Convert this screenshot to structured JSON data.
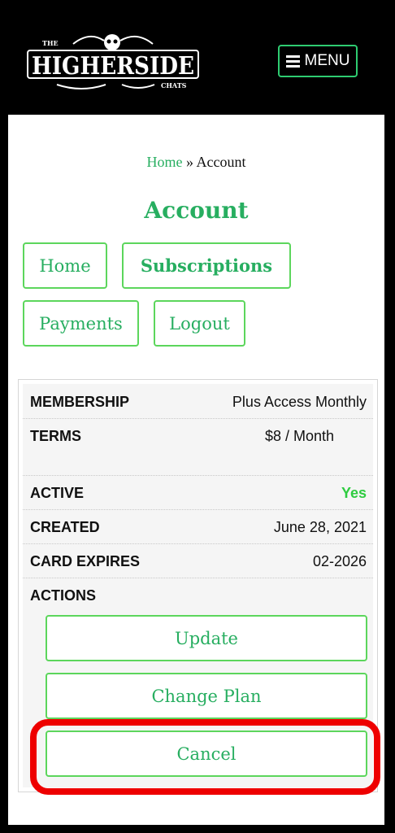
{
  "header": {
    "logo": {
      "top_text": "THE",
      "main_text": "HIGHERSIDE",
      "bottom_text": "CHATS"
    },
    "menu_label": "MENU"
  },
  "breadcrumb": {
    "home": "Home",
    "separator": "»",
    "current": "Account"
  },
  "page_title": "Account",
  "nav": {
    "home": "Home",
    "subscriptions": "Subscriptions",
    "payments": "Payments",
    "logout": "Logout"
  },
  "subscription": {
    "membership_label": "MEMBERSHIP",
    "membership_value": "Plus Access Monthly",
    "terms_label": "TERMS",
    "terms_value": "$8 / Month",
    "active_label": "ACTIVE",
    "active_value": "Yes",
    "created_label": "CREATED",
    "created_value": "June 28, 2021",
    "card_expires_label": "CARD EXPIRES",
    "card_expires_value": "02-2026",
    "actions_label": "ACTIONS"
  },
  "actions": {
    "update": "Update",
    "change_plan": "Change Plan",
    "cancel": "Cancel"
  },
  "colors": {
    "accent": "#27ae60",
    "border": "#5cd65c",
    "highlight": "#ee0000",
    "header_bg": "#000000"
  }
}
